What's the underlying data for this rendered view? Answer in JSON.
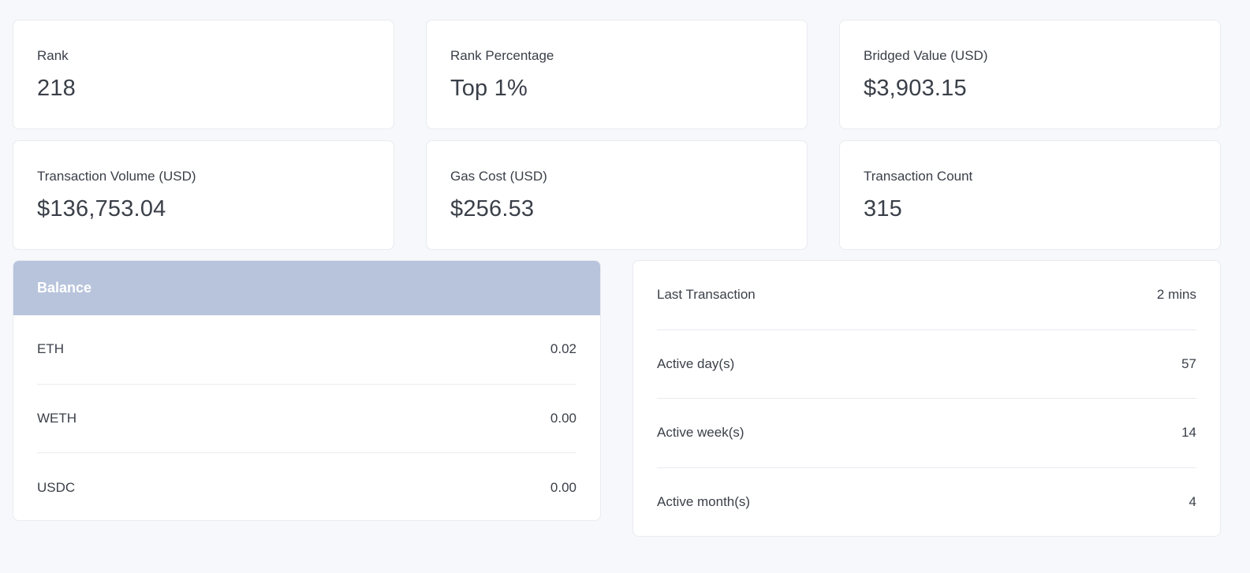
{
  "stats": [
    {
      "label": "Rank",
      "value": "218"
    },
    {
      "label": "Rank Percentage",
      "value": "Top 1%"
    },
    {
      "label": "Bridged Value (USD)",
      "value": "$3,903.15"
    },
    {
      "label": "Transaction Volume (USD)",
      "value": "$136,753.04"
    },
    {
      "label": "Gas Cost (USD)",
      "value": "$256.53"
    },
    {
      "label": "Transaction Count",
      "value": "315"
    }
  ],
  "balance": {
    "title": "Balance",
    "header_color": "#b8c4dc",
    "rows": [
      {
        "token": "ETH",
        "amount": "0.02"
      },
      {
        "token": "WETH",
        "amount": "0.00"
      },
      {
        "token": "USDC",
        "amount": "0.00"
      }
    ]
  },
  "activity": {
    "rows": [
      {
        "label": "Last Transaction",
        "value": "2 mins"
      },
      {
        "label": "Active day(s)",
        "value": "57"
      },
      {
        "label": "Active week(s)",
        "value": "14"
      },
      {
        "label": "Active month(s)",
        "value": "4"
      }
    ]
  }
}
